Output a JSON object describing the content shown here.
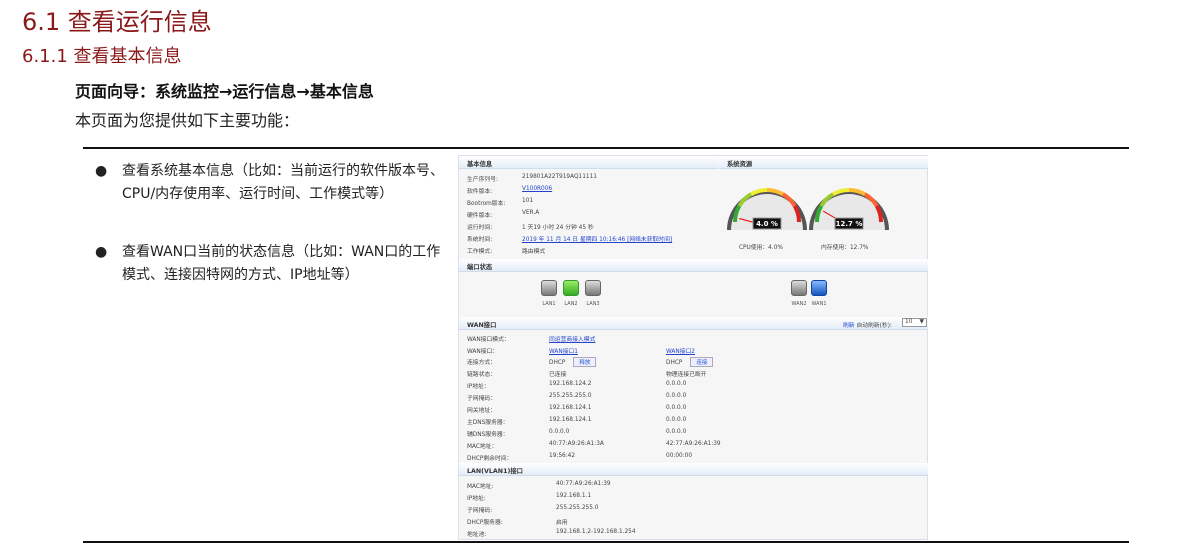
{
  "doc": {
    "section_title": "6.1  查看运行信息",
    "subsection_title": "6.1.1  查看基本信息",
    "navigation": "页面向导：系统监控→运行信息→基本信息",
    "intro": "本页面为您提供如下主要功能：",
    "bullets": [
      "查看系统基本信息（比如：当前运行的软件版本号、CPU/内存使用率、运行时间、工作模式等）",
      "查看WAN口当前的状态信息（比如：WAN口的工作模式、连接因特网的方式、IP地址等）"
    ]
  },
  "shot": {
    "basic": {
      "title": "基本信息",
      "rows": [
        {
          "label": "生产序列号:",
          "value": "219801A22T919AQ11111"
        },
        {
          "label": "软件版本:",
          "value": "V100R006",
          "link": true
        },
        {
          "label": "Bootrom版本:",
          "value": "101"
        },
        {
          "label": "硬件版本:",
          "value": "VER.A"
        },
        {
          "label": "运行时间:",
          "value": "1 天19 小时 24 分钟 45 秒"
        },
        {
          "label": "系统时间:",
          "value": "2019 年 11 月 14 日 星期四 10:16:46  [网络未获取时间]",
          "link": true
        },
        {
          "label": "工作模式:",
          "value": "路由模式"
        }
      ]
    },
    "resources": {
      "title": "系统资源",
      "cpu_value": 4.0,
      "cpu_display": "4.0 %",
      "cpu_label": "CPU使用：4.0%",
      "mem_value": 12.7,
      "mem_display": "12.7 %",
      "mem_label": "内存使用：12.7%"
    },
    "ports": {
      "title": "端口状态",
      "lan": [
        {
          "name": "LAN1",
          "state": "gray"
        },
        {
          "name": "LAN2",
          "state": "green"
        },
        {
          "name": "LAN3",
          "state": "gray"
        }
      ],
      "wan": [
        {
          "name": "WAN2",
          "state": "gray"
        },
        {
          "name": "WAN1",
          "state": "blue"
        }
      ]
    },
    "wan": {
      "title": "WAN接口",
      "refresh": "刷新",
      "auto_refresh_label": "自动刷新(秒):",
      "auto_refresh_value": "10",
      "mode_label": "WAN接口模式：",
      "mode_value": "同运营商接入模式",
      "port_label": "WAN接口：",
      "port1": "WAN接口1",
      "port2": "WAN接口2",
      "conn_label": "连接方式：",
      "conn1": "DHCP",
      "btn1": "释放",
      "conn2": "DHCP",
      "btn2": "连接",
      "rows": [
        {
          "label": "链路状态：",
          "v1": "已连接",
          "v2": "物理连接已断开"
        },
        {
          "label": "IP地址：",
          "v1": "192.168.124.2",
          "v2": "0.0.0.0"
        },
        {
          "label": "子网掩码：",
          "v1": "255.255.255.0",
          "v2": "0.0.0.0"
        },
        {
          "label": "网关地址：",
          "v1": "192.168.124.1",
          "v2": "0.0.0.0"
        },
        {
          "label": "主DNS服务器：",
          "v1": "192.168.124.1",
          "v2": "0.0.0.0"
        },
        {
          "label": "辅DNS服务器：",
          "v1": "0.0.0.0",
          "v2": "0.0.0.0"
        },
        {
          "label": "MAC地址：",
          "v1": "40:77:A9:26:A1:3A",
          "v2": "42:77:A9:26:A1:39"
        },
        {
          "label": "DHCP剩余时间：",
          "v1": "19:56:42",
          "v2": "00:00:00"
        }
      ]
    },
    "lan": {
      "title": "LAN(VLAN1)接口",
      "rows": [
        {
          "label": "MAC地址:",
          "value": "40:77:A9:26:A1:39"
        },
        {
          "label": "IP地址:",
          "value": "192.168.1.1"
        },
        {
          "label": "子网掩码:",
          "value": "255.255.255.0"
        },
        {
          "label": "DHCP服务器:",
          "value": "启用"
        },
        {
          "label": "地址池:",
          "value": "192.168.1.2-192.168.1.254"
        }
      ]
    }
  }
}
